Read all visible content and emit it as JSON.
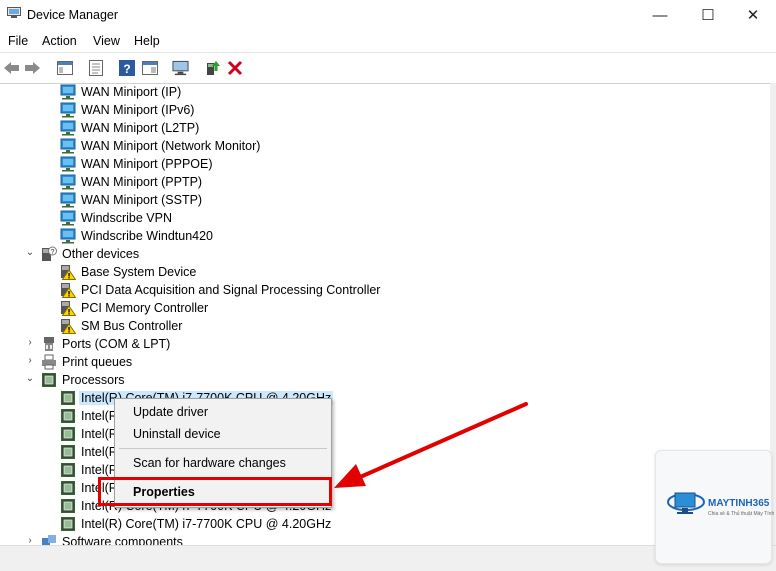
{
  "window": {
    "title": "Device Manager",
    "minimize": "—",
    "maximize": "☐",
    "close": "✕"
  },
  "menu": [
    "File",
    "Action",
    "View",
    "Help"
  ],
  "tree": [
    {
      "label": "WAN Miniport (IP)",
      "icon": "network-adapter-icon",
      "level": 2
    },
    {
      "label": "WAN Miniport (IPv6)",
      "icon": "network-adapter-icon",
      "level": 2
    },
    {
      "label": "WAN Miniport (L2TP)",
      "icon": "network-adapter-icon",
      "level": 2
    },
    {
      "label": "WAN Miniport (Network Monitor)",
      "icon": "network-adapter-icon",
      "level": 2
    },
    {
      "label": "WAN Miniport (PPPOE)",
      "icon": "network-adapter-icon",
      "level": 2
    },
    {
      "label": "WAN Miniport (PPTP)",
      "icon": "network-adapter-icon",
      "level": 2
    },
    {
      "label": "WAN Miniport (SSTP)",
      "icon": "network-adapter-icon",
      "level": 2
    },
    {
      "label": "Windscribe VPN",
      "icon": "network-adapter-icon",
      "level": 2
    },
    {
      "label": "Windscribe Windtun420",
      "icon": "network-adapter-icon",
      "level": 2
    },
    {
      "label": "Other devices",
      "icon": "unknown-device-icon",
      "level": 1,
      "expander": "expanded"
    },
    {
      "label": "Base System Device",
      "icon": "warning-device-icon",
      "level": 2
    },
    {
      "label": "PCI Data Acquisition and Signal Processing Controller",
      "icon": "warning-device-icon",
      "level": 2
    },
    {
      "label": "PCI Memory Controller",
      "icon": "warning-device-icon",
      "level": 2
    },
    {
      "label": "SM Bus Controller",
      "icon": "warning-device-icon",
      "level": 2
    },
    {
      "label": "Ports (COM & LPT)",
      "icon": "port-icon",
      "level": 1,
      "expander": "collapsed"
    },
    {
      "label": "Print queues",
      "icon": "printer-icon",
      "level": 1,
      "expander": "collapsed"
    },
    {
      "label": "Processors",
      "icon": "processor-icon",
      "level": 1,
      "expander": "expanded"
    },
    {
      "label": "Intel(R) Core(TM) i7-7700K CPU @ 4.20GHz",
      "icon": "processor-icon",
      "level": 2,
      "selected": true
    },
    {
      "label": "Intel(R) Core(TM) i7-7700K CPU @ 4.20GHz",
      "icon": "processor-icon",
      "level": 2
    },
    {
      "label": "Intel(R) Core(TM) i7-7700K CPU @ 4.20GHz",
      "icon": "processor-icon",
      "level": 2
    },
    {
      "label": "Intel(R) Core(TM) i7-7700K CPU @ 4.20GHz",
      "icon": "processor-icon",
      "level": 2
    },
    {
      "label": "Intel(R) Core(TM) i7-7700K CPU @ 4.20GHz",
      "icon": "processor-icon",
      "level": 2
    },
    {
      "label": "Intel(R) Core(TM) i7-7700K CPU @ 4.20GHz",
      "icon": "processor-icon",
      "level": 2
    },
    {
      "label": "Intel(R) Core(TM) i7-7700K CPU @ 4.20GHz",
      "icon": "processor-icon",
      "level": 2
    },
    {
      "label": "Intel(R) Core(TM) i7-7700K CPU @ 4.20GHz",
      "icon": "processor-icon",
      "level": 2
    },
    {
      "label": "Software components",
      "icon": "software-component-icon",
      "level": 1,
      "expander": "collapsed"
    }
  ],
  "context_menu": {
    "update": "Update driver",
    "uninstall": "Uninstall device",
    "scan": "Scan for hardware changes",
    "properties": "Properties"
  },
  "watermark": {
    "brand": "MAYTINH365",
    "tagline": "Chia sẻ & Thủ thuật Máy Tính"
  },
  "colors": {
    "highlight": "#e30000",
    "selection": "#cce8ff",
    "network": "#2a8fd6"
  }
}
